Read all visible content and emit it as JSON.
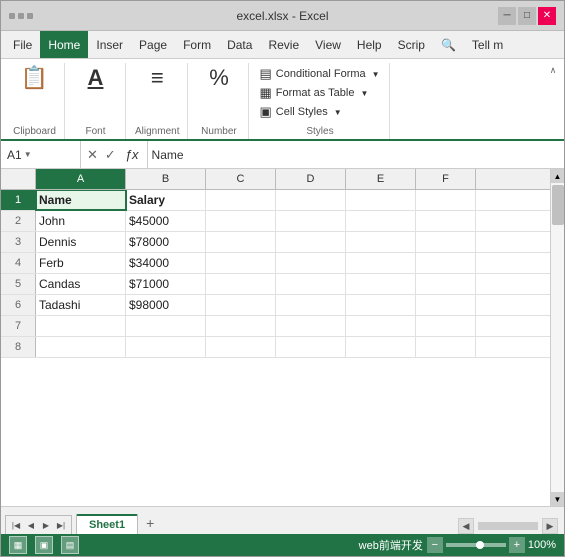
{
  "window": {
    "title": "excel.xlsx - Excel"
  },
  "title_bar": {
    "title": "excel.xlsx  -  Excel",
    "minimize": "─",
    "maximize": "□",
    "close": "✕"
  },
  "menu_bar": {
    "items": [
      {
        "id": "file",
        "label": "File"
      },
      {
        "id": "home",
        "label": "Home",
        "active": true
      },
      {
        "id": "insert",
        "label": "Inser"
      },
      {
        "id": "page",
        "label": "Page"
      },
      {
        "id": "form",
        "label": "Form"
      },
      {
        "id": "data",
        "label": "Data"
      },
      {
        "id": "review",
        "label": "Revie"
      },
      {
        "id": "view",
        "label": "View"
      },
      {
        "id": "help",
        "label": "Help"
      },
      {
        "id": "script",
        "label": "Scrip"
      },
      {
        "id": "search_icon",
        "label": "🔍"
      },
      {
        "id": "tell_me",
        "label": "Tell m"
      }
    ]
  },
  "ribbon": {
    "groups": [
      {
        "id": "clipboard",
        "label": "Clipboard",
        "buttons": [
          {
            "id": "paste",
            "icon": "📋",
            "label": ""
          }
        ]
      },
      {
        "id": "font",
        "label": "Font",
        "buttons": [
          {
            "id": "font-btn",
            "icon": "A̲",
            "label": ""
          }
        ]
      },
      {
        "id": "alignment",
        "label": "Alignment",
        "buttons": [
          {
            "id": "alignment-btn",
            "icon": "≡",
            "label": ""
          }
        ]
      },
      {
        "id": "number",
        "label": "Number",
        "buttons": [
          {
            "id": "number-btn",
            "icon": "%",
            "label": ""
          }
        ]
      }
    ],
    "styles_group": {
      "label": "Styles",
      "items": [
        {
          "id": "conditional",
          "icon": "▤",
          "label": "Conditional Forma"
        },
        {
          "id": "format-table",
          "icon": "▦",
          "label": "Format as Table"
        },
        {
          "id": "cell-styles",
          "icon": "▣",
          "label": "Cell Styles"
        }
      ]
    },
    "collapse_label": "∧"
  },
  "formula_bar": {
    "cell_ref": "A1",
    "fx": "ƒx",
    "cancel": "✕",
    "confirm": "✓",
    "value": "Name"
  },
  "spreadsheet": {
    "col_headers": [
      "A",
      "B",
      "C",
      "D",
      "E",
      "F"
    ],
    "rows": [
      {
        "num": 1,
        "cells": [
          "Name",
          "Salary",
          "",
          "",
          "",
          ""
        ],
        "is_header": true
      },
      {
        "num": 2,
        "cells": [
          "John",
          "$45000",
          "",
          "",
          "",
          ""
        ]
      },
      {
        "num": 3,
        "cells": [
          "Dennis",
          "$78000",
          "",
          "",
          "",
          ""
        ]
      },
      {
        "num": 4,
        "cells": [
          "Ferb",
          "$34000",
          "",
          "",
          "",
          ""
        ]
      },
      {
        "num": 5,
        "cells": [
          "Candas",
          "$71000",
          "",
          "",
          "",
          ""
        ]
      },
      {
        "num": 6,
        "cells": [
          "Tadashi",
          "$98000",
          "",
          "",
          "",
          ""
        ]
      },
      {
        "num": 7,
        "cells": [
          "",
          "",
          "",
          "",
          "",
          ""
        ]
      },
      {
        "num": 8,
        "cells": [
          "",
          "",
          "",
          "",
          "",
          ""
        ]
      }
    ],
    "selected_cell": {
      "row": 1,
      "col": 0
    }
  },
  "sheet_tabs": {
    "active": "Sheet1",
    "tabs": [
      "Sheet1"
    ],
    "add_label": "+",
    "nav_prev": "◀",
    "nav_next": "▶"
  },
  "status_bar": {
    "view_icons": [
      "▦",
      "▣",
      "▤"
    ],
    "zoom_minus": "−",
    "zoom_plus": "+",
    "zoom_level": "100%",
    "watermark": "web前端开发"
  }
}
